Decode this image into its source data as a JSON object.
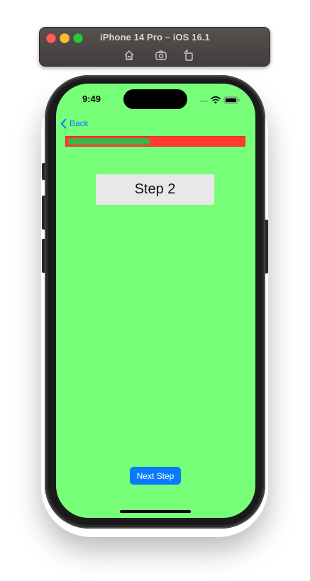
{
  "simulator": {
    "title": "iPhone 14 Pro – iOS 16.1",
    "buttons": [
      "home-icon",
      "screenshot-icon",
      "rotate-icon"
    ]
  },
  "status_bar": {
    "time": "9:49",
    "icons": [
      "signal-dots-icon",
      "wifi-icon",
      "battery-icon"
    ]
  },
  "nav": {
    "back_label": "Back"
  },
  "progress": {
    "value": 0.47,
    "track_color": "#ff3b30",
    "fill_color": "#3fb248"
  },
  "main": {
    "step_label": "Step 2",
    "background_color": "#77ff79"
  },
  "footer": {
    "next_label": "Next Step",
    "accent_color": "#0a7aff"
  }
}
